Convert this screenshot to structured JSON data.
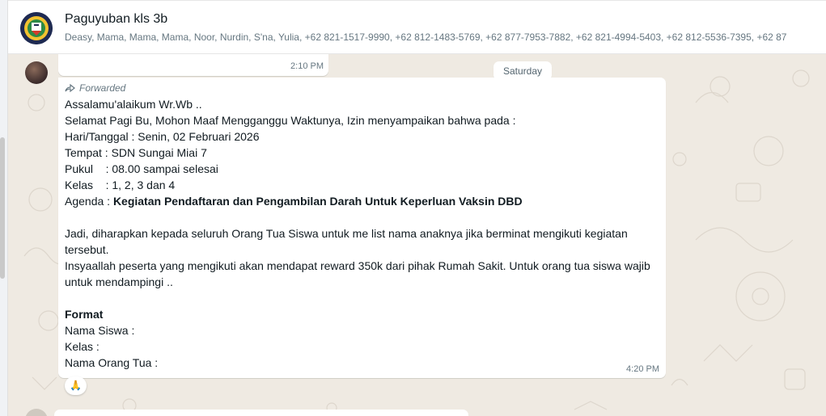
{
  "header": {
    "title": "Paguyuban kls 3b",
    "members": "Deasy, Mama, Mama, Mama, Noor, Nurdin, S'na, Yulia, +62 821-1517-9990, +62 812-1483-5769, +62 877-7953-7882, +62 821-4994-5403, +62 812-5536-7395, +62 87"
  },
  "chat": {
    "previous_message": {
      "time": "2:10 PM"
    },
    "date_divider": "Saturday",
    "message": {
      "forwarded_label": "Forwarded",
      "lines": [
        "Assalamu'alaikum Wr.Wb ..",
        "Selamat Pagi Bu, Mohon Maaf Mengganggu Waktunya, Izin menyampaikan bahwa pada :",
        "Hari/Tanggal : Senin, 02 Februari 2026",
        "Tempat : SDN Sungai Miai 7",
        "Pukul    : 08.00 sampai selesai",
        "Kelas    : 1, 2, 3 dan 4"
      ],
      "agenda_label": "Agenda : ",
      "agenda_value": "Kegiatan Pendaftaran dan Pengambilan Darah Untuk Keperluan Vaksin DBD",
      "paragraph_1": "Jadi, diharapkan kepada seluruh Orang Tua Siswa untuk me list nama anaknya jika berminat mengikuti kegiatan tersebut.",
      "paragraph_2": "Insyaallah peserta yang mengikuti akan mendapat reward 350k dari pihak Rumah Sakit. Untuk orang tua siswa wajib untuk mendampingi ..",
      "format_title": "Format",
      "format_fields": [
        "Nama Siswa :",
        "Kelas :",
        "Nama Orang Tua :"
      ],
      "time": "4:20 PM",
      "reaction": "🙏"
    }
  }
}
